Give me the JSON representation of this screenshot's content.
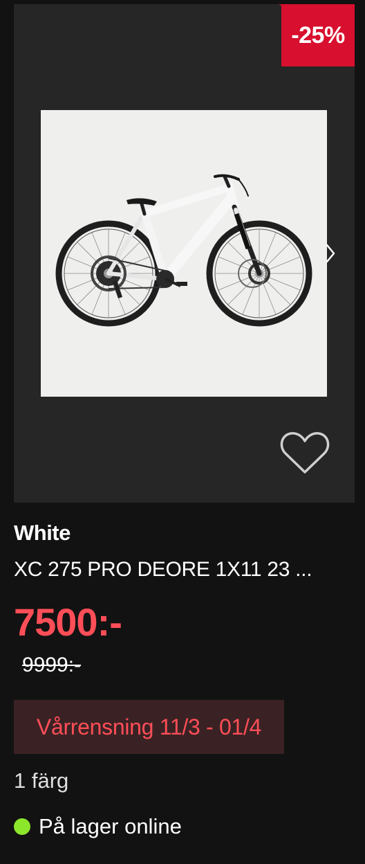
{
  "discount_badge": "-25%",
  "color_name": "White",
  "product_name": "XC 275 PRO DEORE 1X11 23 ...",
  "price": "7500:-",
  "original_price": "9999:-",
  "campaign_label": "Vårrensning 11/3 - 01/4",
  "colors_count": "1 färg",
  "stock_status": "På lager online",
  "icons": {
    "next": "chevron-right-icon",
    "favorite": "heart-outline-icon",
    "stock": "in-stock-dot-icon"
  },
  "colors": {
    "badge": "#d80f2e",
    "price": "#ff4e57",
    "campaign_bg": "#3a2224",
    "stock_dot": "#8ce62a"
  }
}
